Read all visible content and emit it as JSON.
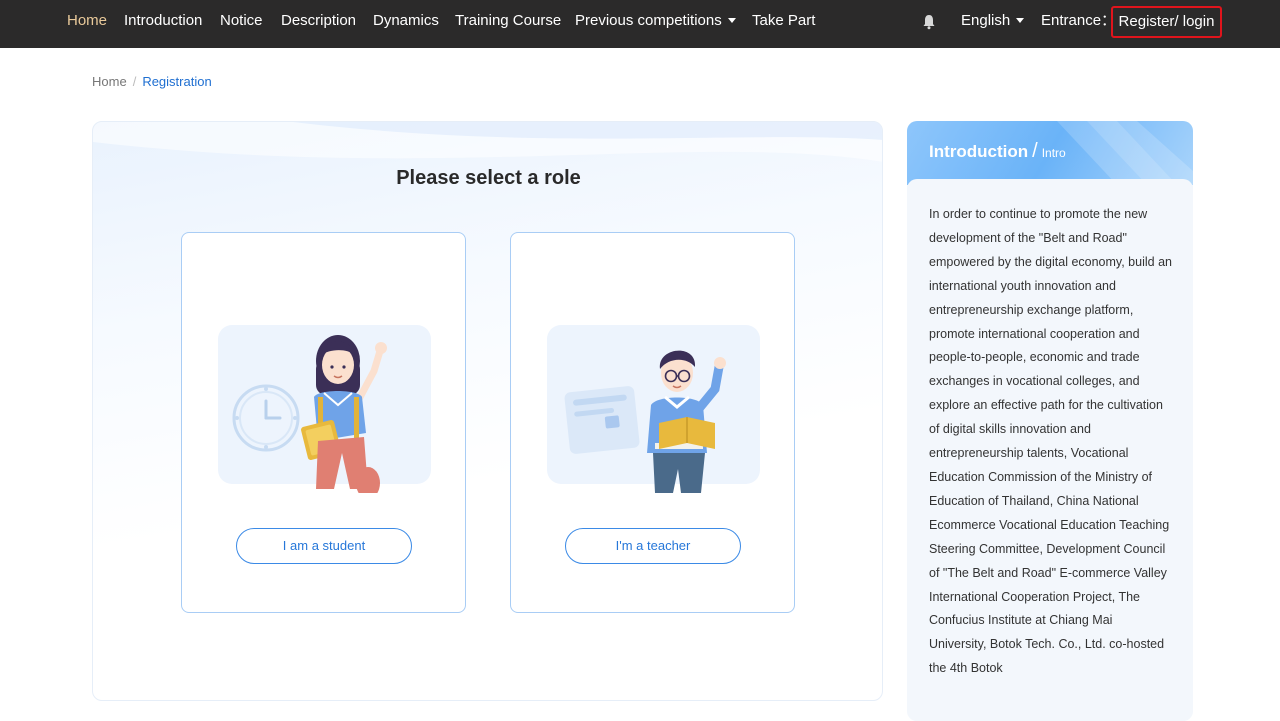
{
  "nav": {
    "items": [
      {
        "label": "Home",
        "active": true
      },
      {
        "label": "Introduction"
      },
      {
        "label": "Notice"
      },
      {
        "label": "Description"
      },
      {
        "label": "Dynamics"
      },
      {
        "label": "Training Course"
      },
      {
        "label": "Previous competitions",
        "dropdown": true
      },
      {
        "label": "Take Part"
      }
    ],
    "notification_icon": "bell-icon",
    "language": "English",
    "entrance_label": "Entrance：",
    "register_login": "Register/ login",
    "colors": {
      "bar": "#2b2a2a",
      "active": "#e9c99a",
      "highlight_border": "#e0141c"
    }
  },
  "breadcrumb": {
    "home": "Home",
    "separator": "/",
    "current": "Registration"
  },
  "role_select": {
    "title": "Please select a role",
    "roles": [
      {
        "label": "I am a student",
        "illustration": "student-illustration"
      },
      {
        "label": "I'm a teacher",
        "illustration": "teacher-illustration"
      }
    ],
    "accent": "#2677d9"
  },
  "intro": {
    "title": "Introduction",
    "separator": "/",
    "subtitle": "Intro",
    "text": "In order to continue to promote the new development of the \"Belt and Road\" empowered by the digital economy, build an international youth innovation and entrepreneurship exchange platform, promote international cooperation and people-to-people, economic and trade exchanges in vocational colleges, and explore an effective path for the cultivation of digital skills innovation and entrepreneurship talents, Vocational Education Commission of the Ministry of Education of Thailand, China National Ecommerce Vocational Education Teaching Steering Committee, Development Council of \"The Belt and Road\" E-commerce Valley International Cooperation Project, The Confucius Institute at Chiang Mai University, Botok Tech. Co., Ltd. co-hosted the 4th Botok"
  }
}
